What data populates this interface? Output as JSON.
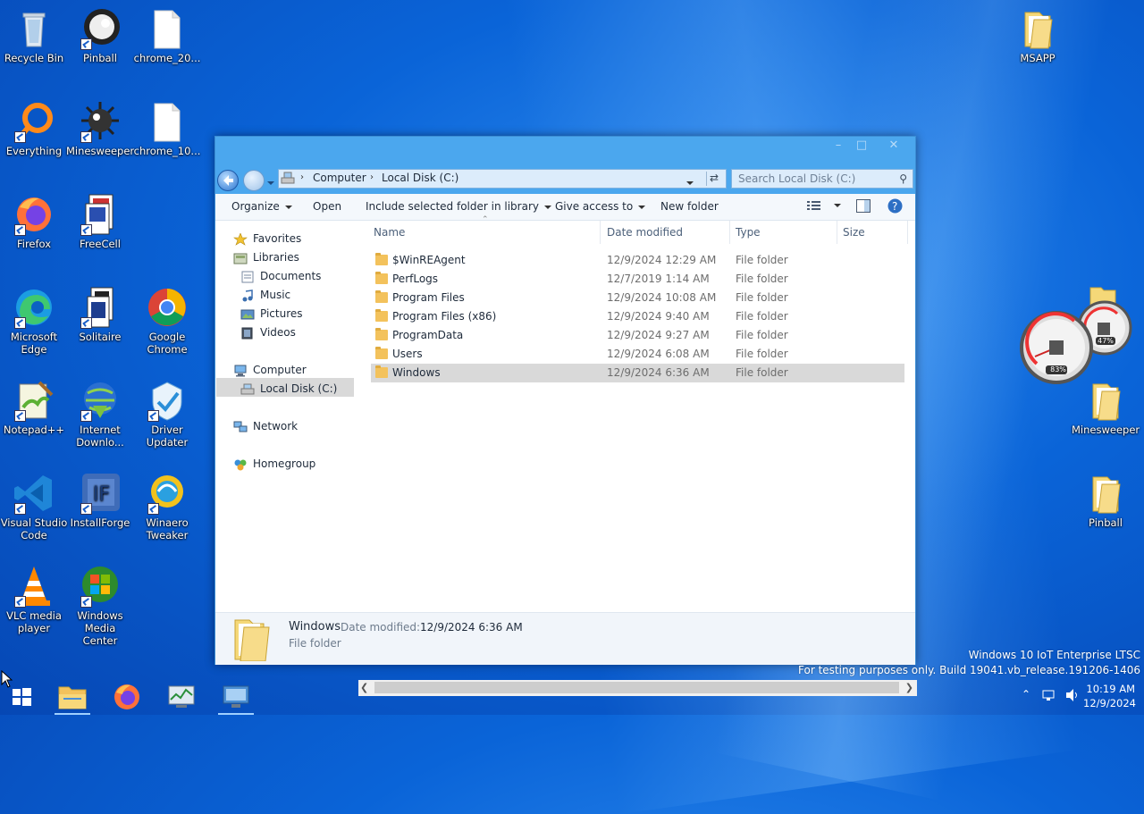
{
  "desktop": {
    "icons": [
      {
        "label": "Recycle Bin"
      },
      {
        "label": "Pinball"
      },
      {
        "label": "chrome_20..."
      },
      {
        "label": "Everything"
      },
      {
        "label": "Minesweeper"
      },
      {
        "label": "chrome_10..."
      },
      {
        "label": "Firefox"
      },
      {
        "label": "FreeCell"
      },
      {
        "label": "Microsoft Edge"
      },
      {
        "label": "Solitaire"
      },
      {
        "label": "Google Chrome"
      },
      {
        "label": "Notepad++"
      },
      {
        "label": "Internet Downlo..."
      },
      {
        "label": "Driver Updater"
      },
      {
        "label": "Visual Studio Code"
      },
      {
        "label": "InstallForge"
      },
      {
        "label": "Winaero Tweaker"
      },
      {
        "label": "VLC media player"
      },
      {
        "label": "Windows Media Center"
      },
      {
        "label": "MSAPP"
      },
      {
        "label": "Minesweeper"
      },
      {
        "label": "Pinball"
      }
    ],
    "gadget": {
      "cpu": "83%",
      "memory": "47%"
    }
  },
  "explorer": {
    "breadcrumb": [
      "Computer",
      "Local Disk (C:)"
    ],
    "search_placeholder": "Search Local Disk (C:)",
    "toolbar": {
      "organize": "Organize",
      "open": "Open",
      "include": "Include selected folder in library",
      "share": "Give access to",
      "new_folder": "New folder"
    },
    "nav": {
      "favorites": "Favorites",
      "libraries": "Libraries",
      "documents": "Documents",
      "music": "Music",
      "pictures": "Pictures",
      "videos": "Videos",
      "computer": "Computer",
      "local_disk": "Local Disk (C:)",
      "network": "Network",
      "homegroup": "Homegroup"
    },
    "columns": {
      "name": "Name",
      "date": "Date modified",
      "type": "Type",
      "size": "Size"
    },
    "files": [
      {
        "name": "$WinREAgent",
        "date": "12/9/2024 12:29 AM",
        "type": "File folder"
      },
      {
        "name": "PerfLogs",
        "date": "12/7/2019 1:14 AM",
        "type": "File folder"
      },
      {
        "name": "Program Files",
        "date": "12/9/2024 10:08 AM",
        "type": "File folder"
      },
      {
        "name": "Program Files (x86)",
        "date": "12/9/2024 9:40 AM",
        "type": "File folder"
      },
      {
        "name": "ProgramData",
        "date": "12/9/2024 9:27 AM",
        "type": "File folder"
      },
      {
        "name": "Users",
        "date": "12/9/2024 6:08 AM",
        "type": "File folder"
      },
      {
        "name": "Windows",
        "date": "12/9/2024 6:36 AM",
        "type": "File folder"
      }
    ],
    "selected_index": 6,
    "details": {
      "name": "Windows",
      "date_label": "Date modified:",
      "date_value": "12/9/2024 6:36 AM",
      "type": "File folder"
    }
  },
  "watermark": {
    "line1": "Windows 10 IoT Enterprise LTSC",
    "line2": "For testing purposes only. Build 19041.vb_release.191206-1406"
  },
  "tray": {
    "time": "10:19 AM",
    "date": "12/9/2024"
  },
  "colors": {
    "desktop": "#0a64d8",
    "window_frame": "#4ba7ee",
    "selection": "#d9d9d9"
  }
}
